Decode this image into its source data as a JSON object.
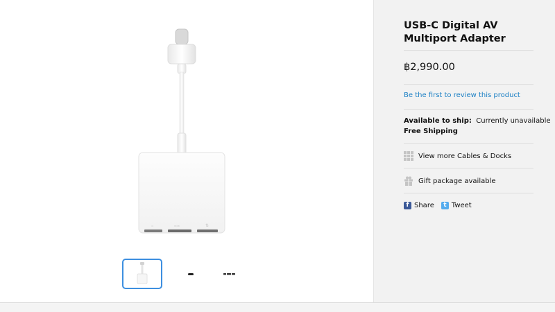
{
  "product": {
    "title": "USB-C Digital AV Multiport Adapter",
    "price": "฿2,990.00",
    "review_link": "Be the first to review this product",
    "availability_label": "Available to ship:",
    "availability_value": "Currently unavailable",
    "shipping": "Free Shipping",
    "more_link": "View more Cables & Docks",
    "gift_link": "Gift package available"
  },
  "social": {
    "share_label": "Share",
    "tweet_label": "Tweet"
  },
  "gallery": {
    "thumbnails": [
      "front-view",
      "usb-c-end",
      "ports-view"
    ],
    "active_thumbnail": 0
  },
  "colors": {
    "link": "#1a7fc4",
    "facebook": "#3b5998",
    "twitter": "#55acee",
    "thumb_active_border": "#3d8fe0",
    "panel_bg": "#f2f2f2"
  },
  "icons": {
    "more": "grid-icon",
    "gift": "gift-icon",
    "share": "facebook-icon",
    "tweet": "twitter-icon"
  }
}
